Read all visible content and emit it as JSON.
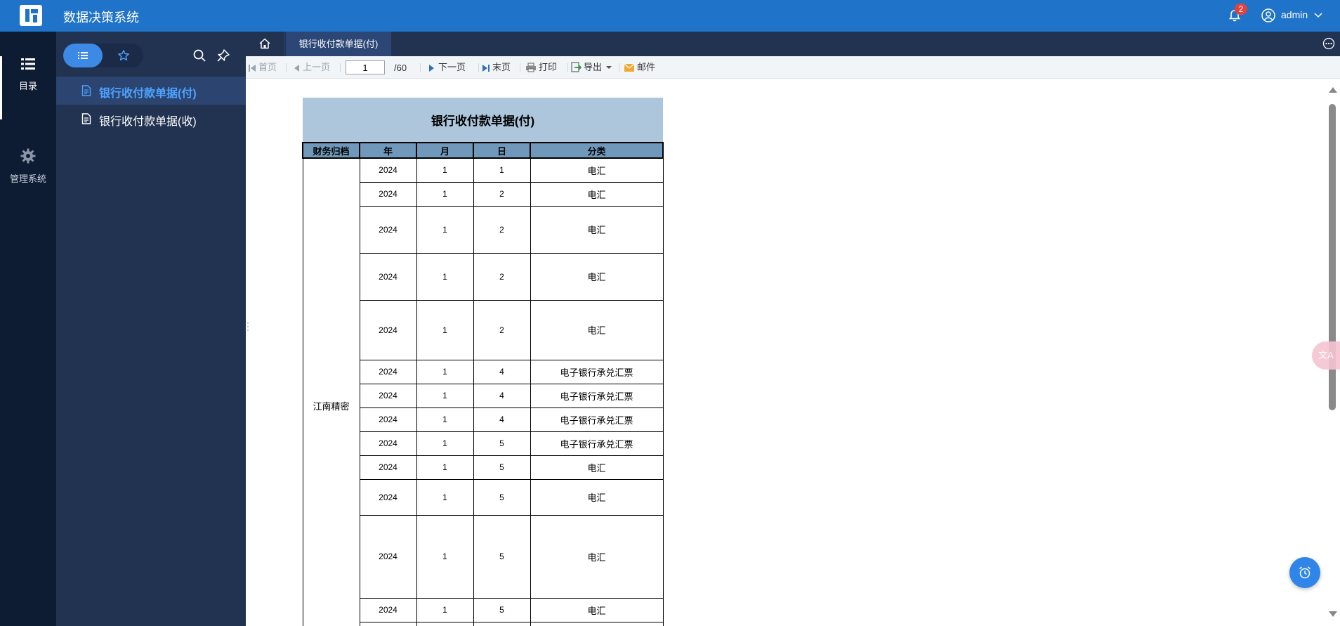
{
  "app": {
    "title": "数据决策系统"
  },
  "header": {
    "notification_count": "2",
    "username": "admin"
  },
  "rail": [
    {
      "label": "目录",
      "icon": "list-icon",
      "active": true
    },
    {
      "label": "管理系统",
      "icon": "gear-icon",
      "active": false
    }
  ],
  "tree": {
    "items": [
      {
        "label": "银行收付款单据(付)",
        "active": true
      },
      {
        "label": "银行收付款单据(收)",
        "active": false
      }
    ]
  },
  "tabs": {
    "active_tab": "银行收付款单据(付)"
  },
  "toolbar": {
    "first": "首页",
    "prev": "上一页",
    "page": "1",
    "total": "/60",
    "next": "下一页",
    "last": "末页",
    "print": "打印",
    "export": "导出",
    "mail": "邮件"
  },
  "report": {
    "title": "银行收付款单据(付)",
    "headers": [
      "财务归档",
      "年",
      "月",
      "日",
      "分类"
    ],
    "group_label": "江南精密",
    "rows": [
      {
        "year": "2024",
        "month": "1",
        "day": "1",
        "category": "电汇"
      },
      {
        "year": "2024",
        "month": "1",
        "day": "2",
        "category": "电汇"
      },
      {
        "year": "2024",
        "month": "1",
        "day": "2",
        "category": "电汇"
      },
      {
        "year": "2024",
        "month": "1",
        "day": "2",
        "category": "电汇"
      },
      {
        "year": "2024",
        "month": "1",
        "day": "2",
        "category": "电汇"
      },
      {
        "year": "2024",
        "month": "1",
        "day": "4",
        "category": "电子银行承兑汇票"
      },
      {
        "year": "2024",
        "month": "1",
        "day": "4",
        "category": "电子银行承兑汇票"
      },
      {
        "year": "2024",
        "month": "1",
        "day": "4",
        "category": "电子银行承兑汇票"
      },
      {
        "year": "2024",
        "month": "1",
        "day": "5",
        "category": "电子银行承兑汇票"
      },
      {
        "year": "2024",
        "month": "1",
        "day": "5",
        "category": "电汇"
      },
      {
        "year": "2024",
        "month": "1",
        "day": "5",
        "category": "电汇"
      },
      {
        "year": "2024",
        "month": "1",
        "day": "5",
        "category": "电汇"
      },
      {
        "year": "2024",
        "month": "1",
        "day": "5",
        "category": "电汇"
      }
    ]
  },
  "colors": {
    "header_bar": "#1f73c9",
    "rail": "#0d1b33",
    "tree": "#223251",
    "accent": "#3c8ae6",
    "table_title_bg": "#adc6dc",
    "table_head_bg": "#6f98bb"
  }
}
